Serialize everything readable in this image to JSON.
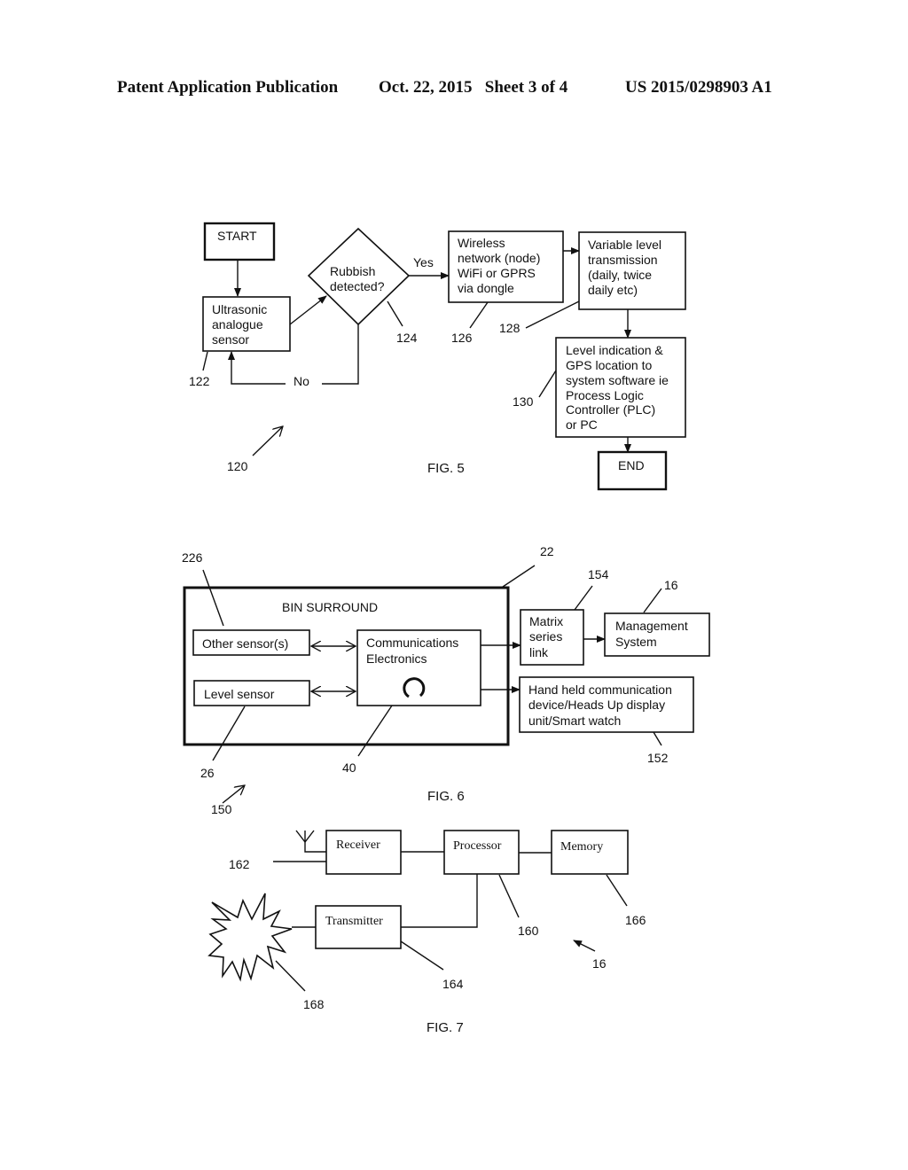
{
  "header": {
    "publication": "Patent Application Publication",
    "date_sheet": "Oct. 22, 2015   Sheet 3 of 4",
    "number": "US 2015/0298903 A1"
  },
  "fig5": {
    "caption": "FIG. 5",
    "start": "START",
    "sensor": [
      "Ultrasonic",
      "analogue",
      "sensor"
    ],
    "decision": [
      "Rubbish",
      "detected?"
    ],
    "yes": "Yes",
    "no": "No",
    "wireless": [
      "Wireless",
      "network (node)",
      "WiFi or GPRS",
      "via dongle"
    ],
    "variable": [
      "Variable level",
      "transmission",
      "(daily, twice",
      "daily etc)"
    ],
    "level": [
      "Level indication &",
      "GPS location to",
      "system software ie",
      "Process Logic",
      "Controller (PLC)",
      "or PC"
    ],
    "end": "END",
    "refs": {
      "r120": "120",
      "r122": "122",
      "r124": "124",
      "r126": "126",
      "r128": "128",
      "r130": "130"
    }
  },
  "fig6": {
    "caption": "FIG. 6",
    "bin_surround": "BIN SURROUND",
    "other_sensors": "Other sensor(s)",
    "level_sensor": "Level sensor",
    "comms": [
      "Communications",
      "Electronics"
    ],
    "matrix": [
      "Matrix",
      "series",
      "link"
    ],
    "management": [
      "Management",
      "System"
    ],
    "handheld": [
      "Hand held communication",
      "device/Heads Up display",
      "unit/Smart watch"
    ],
    "refs": {
      "r226": "226",
      "r22": "22",
      "r154": "154",
      "r16": "16",
      "r26": "26",
      "r40": "40",
      "r152": "152",
      "r150": "150"
    }
  },
  "fig7": {
    "caption": "FIG. 7",
    "receiver": "Receiver",
    "processor": "Processor",
    "memory": "Memory",
    "transmitter": "Transmitter",
    "refs": {
      "r162": "162",
      "r160": "160",
      "r166": "166",
      "r164": "164",
      "r168": "168",
      "r16": "16"
    }
  }
}
